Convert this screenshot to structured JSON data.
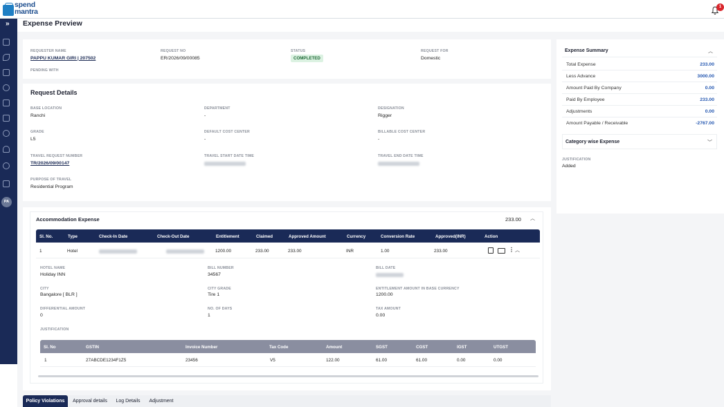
{
  "app": {
    "logo_top": "spend",
    "logo_bottom": "mantra",
    "notification_count": "1"
  },
  "page": {
    "title": "Expense Preview"
  },
  "requester": {
    "name_label": "REQUESTER NAME",
    "name": "PAPPU KUMAR GIRI | 207502",
    "request_no_label": "REQUEST NO",
    "request_no": "ER/2026/09/00085",
    "status_label": "STATUS",
    "status": "COMPLETED",
    "request_for_label": "REQUEST FOR",
    "request_for": "Domestic",
    "pending_with_label": "PENDING WITH"
  },
  "request_details": {
    "title": "Request Details",
    "base_location_label": "BASE LOCATION",
    "base_location": "Ranchi",
    "department_label": "DEPARTMENT",
    "department": "-",
    "designation_label": "DESIGNATION",
    "designation": "Rigger",
    "grade_label": "GRADE",
    "grade": "L5",
    "default_cost_center_label": "DEFAULT COST CENTER",
    "default_cost_center": "-",
    "billable_cost_center_label": "BILLABLE COST CENTER",
    "billable_cost_center": "-",
    "travel_request_number_label": "TRAVEL REQUEST NUMBER",
    "travel_request_number": "TR/2026/09/00147",
    "travel_start_label": "TRAVEL START DATE TIME",
    "travel_end_label": "TRAVEL END DATE TIME",
    "purpose_label": "PURPOSE OF TRAVEL",
    "purpose": "Residential Program"
  },
  "summary": {
    "title": "Expense Summary",
    "rows": [
      {
        "label": "Total Expense",
        "value": "233.00"
      },
      {
        "label": "Less Advance",
        "value": "3000.00"
      },
      {
        "label": "Amount Paid By Company",
        "value": "0.00"
      },
      {
        "label": "Paid By Employee",
        "value": "233.00"
      },
      {
        "label": "Adjustments",
        "value": "0.00"
      },
      {
        "label": "Amount Payable / Receivable",
        "value": "-2767.00"
      }
    ],
    "category_title": "Category wise Expense",
    "justification_label": "JUSTIFICATION",
    "justification": "Added"
  },
  "accommodation": {
    "title": "Accommodation Expense",
    "total": "233.00",
    "headers": [
      "Sl. No.",
      "Type",
      "Check-In Date",
      "Check-Out Date",
      "Entitlement",
      "Claimed",
      "Approved Amount",
      "Currency",
      "Conversion Rate",
      "Approved(INR)",
      "Action"
    ],
    "row": {
      "sl": "1",
      "type": "Hotel",
      "entitlement": "1200.00",
      "claimed": "233.00",
      "approved": "233.00",
      "currency": "INR",
      "conversion": "1.00",
      "approved_inr": "233.00"
    },
    "details": {
      "hotel_name_label": "HOTEL NAME",
      "hotel_name": "Holiday INN",
      "bill_number_label": "BILL NUMBER",
      "bill_number": "34567",
      "bill_date_label": "BILL DATE",
      "city_label": "CITY",
      "city": "Bangalore [ BLR ]",
      "city_grade_label": "CITY GRADE",
      "city_grade": "Tire 1",
      "entitlement_base_label": "ENTITLEMENT AMOUNT IN BASE CURRENCY",
      "entitlement_base": "1200.00",
      "differential_label": "DIFFERENTIAL AMOUNT",
      "differential": "0",
      "days_label": "NO. OF DAYS",
      "days": "1",
      "tax_label": "TAX AMOUNT",
      "tax": "0.00",
      "justification_label": "JUSTIFICATION"
    },
    "gst_headers": [
      "Sl. No",
      "GSTIN",
      "Invoice Number",
      "Tax Code",
      "Amount",
      "SGST",
      "CGST",
      "IGST",
      "UTGST"
    ],
    "gst_row": [
      "1",
      "27ABCDE1234F1Z5",
      "23456",
      "V5",
      "122.00",
      "61.00",
      "61.00",
      "0.00",
      "0.00"
    ]
  },
  "tabs": [
    "Policy Violations",
    "Approval details",
    "Log Details",
    "Adjustment"
  ]
}
